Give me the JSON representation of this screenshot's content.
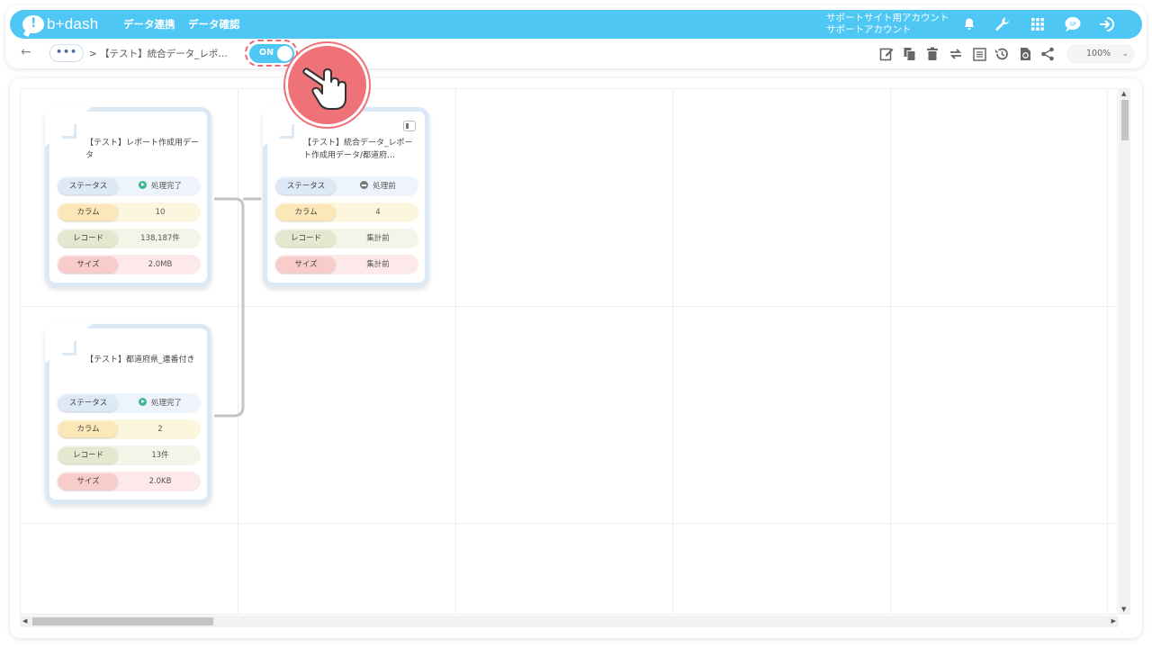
{
  "header": {
    "logo_text": "b+dash",
    "nav": [
      {
        "label": "データ連携"
      },
      {
        "label": "データ確認"
      }
    ],
    "account_line1": "サポートサイト用アカウント",
    "account_line2": "サポートアカウント",
    "icons": [
      "bell-icon",
      "wrench-icon",
      "grid-apps-icon",
      "support-chat-icon",
      "logout-icon"
    ]
  },
  "toolbar": {
    "back_icon": "←",
    "more_label": "•••",
    "breadcrumb": "> 【テスト】統合データ_レポ…",
    "toggle_label": "ON",
    "actions": [
      "edit-icon",
      "copy-icon",
      "trash-icon",
      "sync-icon",
      "table-icon",
      "history-icon",
      "restore-icon",
      "share-icon"
    ],
    "zoom": "100%"
  },
  "nodes": [
    {
      "title": "【テスト】レポート作成用データ",
      "rows": {
        "status_key": "ステータス",
        "status_val": "処理完了",
        "column_key": "カラム",
        "column_val": "10",
        "record_key": "レコード",
        "record_val": "138,187件",
        "size_key": "サイズ",
        "size_val": "2.0MB"
      }
    },
    {
      "title": "【テスト】統合データ_レポート作成用データ/都道府…",
      "rows": {
        "status_key": "ステータス",
        "status_val": "処理前",
        "column_key": "カラム",
        "column_val": "4",
        "record_key": "レコード",
        "record_val": "集計前",
        "size_key": "サイズ",
        "size_val": "集計前"
      }
    },
    {
      "title": "【テスト】都道府県_連番付き",
      "rows": {
        "status_key": "ステータス",
        "status_val": "処理完了",
        "column_key": "カラム",
        "column_val": "2",
        "record_key": "レコード",
        "record_val": "13件",
        "size_key": "サイズ",
        "size_val": "2.0KB"
      }
    }
  ],
  "colors": {
    "accent": "#4ec7f5",
    "highlight": "#ef7278",
    "status_done": "#3db58f"
  }
}
